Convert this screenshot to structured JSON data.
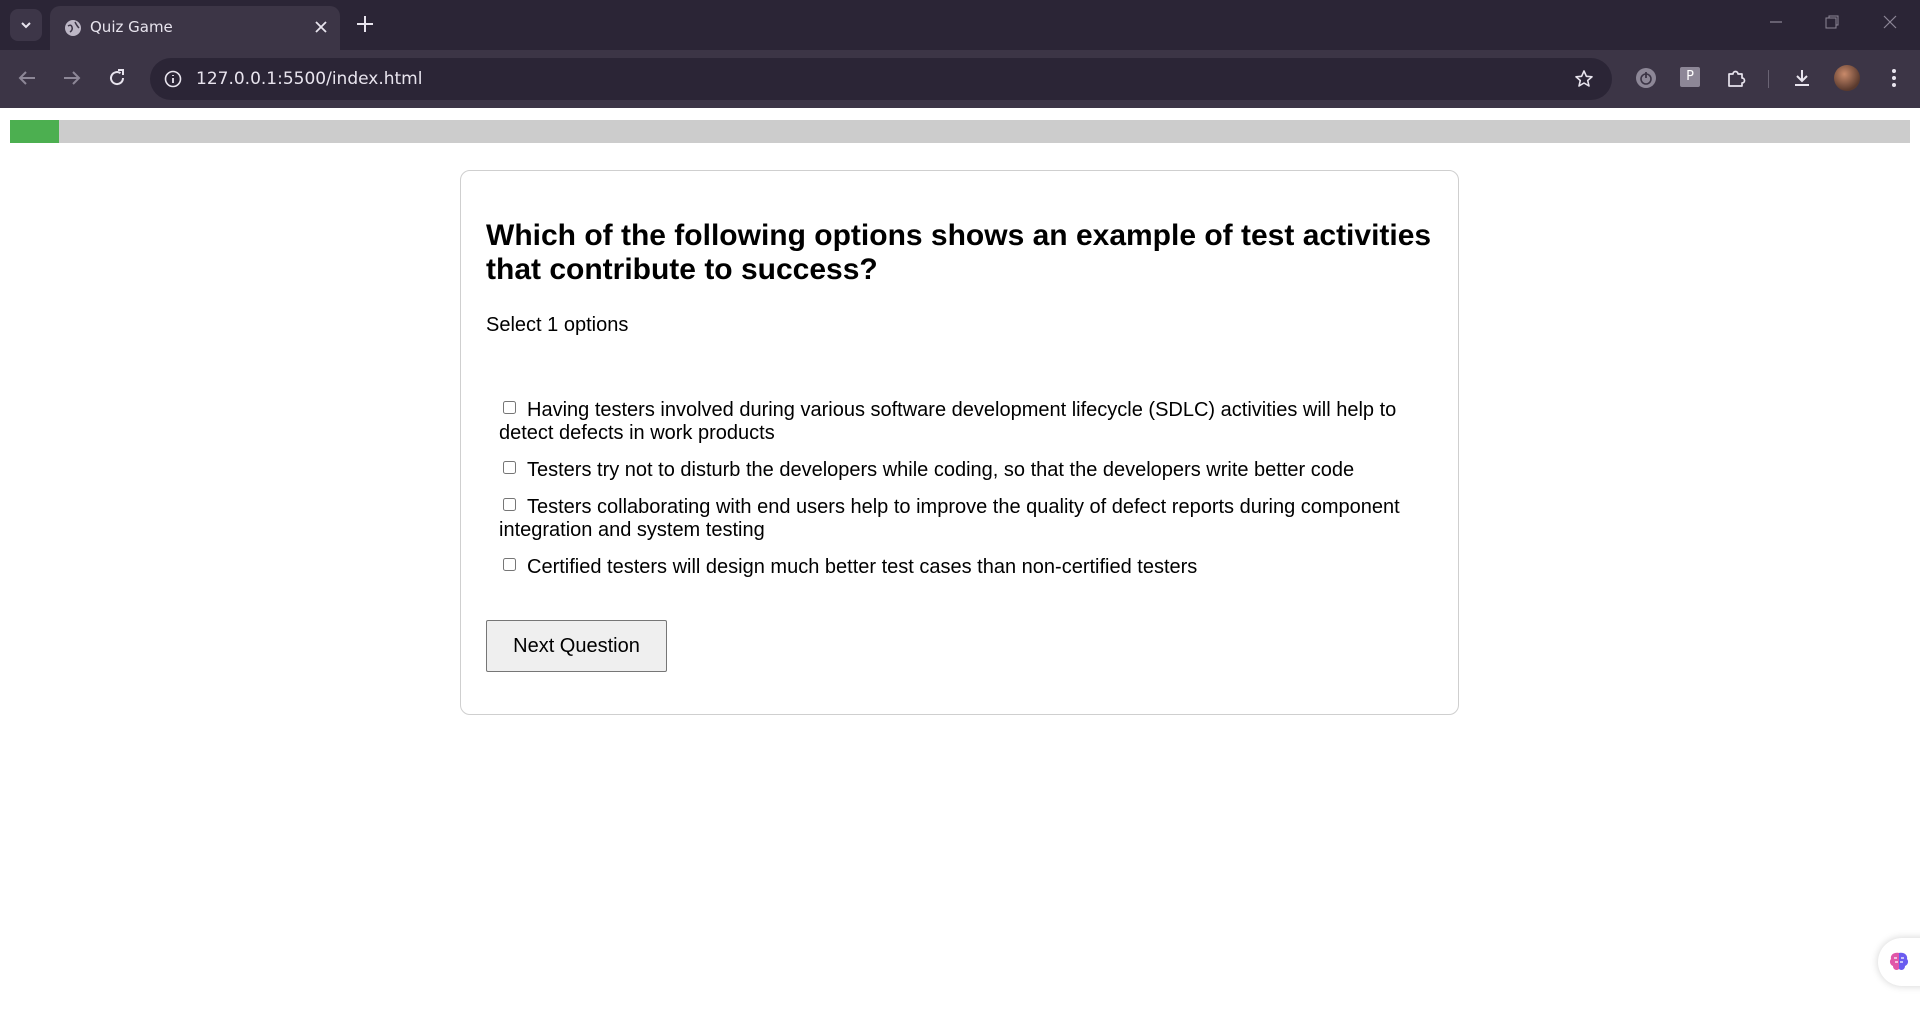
{
  "browser": {
    "tab_title": "Quiz Game",
    "url": "127.0.0.1:5500/index.html",
    "extension_p_label": "P"
  },
  "quiz": {
    "progress_fraction": 0.026,
    "question": "Which of the following options shows an example of test activities that contribute to success?",
    "instruction": "Select 1 options",
    "options": [
      "Having testers involved during various software development lifecycle (SDLC) activities will help to detect defects in work products",
      "Testers try not to disturb the developers while coding, so that the developers write better code",
      "Testers collaborating with end users help to improve the quality of defect reports during component integration and system testing",
      "Certified testers will design much better test cases than non-certified testers"
    ],
    "next_button_label": "Next Question"
  },
  "colors": {
    "progress_fill": "#4caf50",
    "progress_track": "#cccccc",
    "chrome_dark": "#2b2536",
    "chrome_toolbar": "#3c3546"
  },
  "icons": [
    "tab-search-icon",
    "globe-icon",
    "close-icon",
    "plus-icon",
    "back-arrow-icon",
    "forward-arrow-icon",
    "reload-icon",
    "info-icon",
    "star-icon",
    "download-icon",
    "puzzle-icon",
    "menu-dots-icon",
    "brain-icon"
  ]
}
